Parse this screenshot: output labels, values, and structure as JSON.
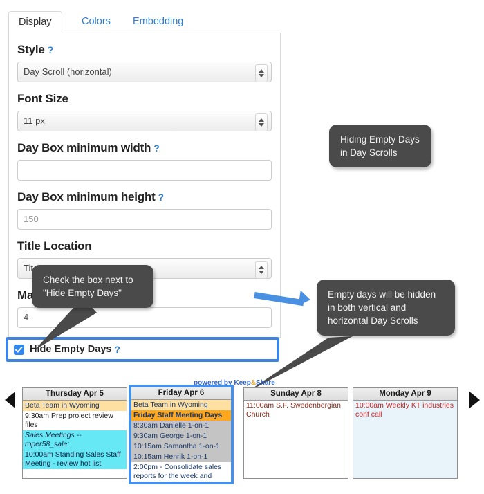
{
  "tabs": [
    {
      "label": "Display",
      "active": true
    },
    {
      "label": "Colors",
      "active": false
    },
    {
      "label": "Embedding",
      "active": false
    }
  ],
  "form": {
    "style": {
      "label": "Style",
      "help": "?",
      "value": "Day Scroll (horizontal)"
    },
    "font_size": {
      "label": "Font Size",
      "value": "11 px"
    },
    "day_box_min_width": {
      "label": "Day Box minimum width",
      "help": "?",
      "value": ""
    },
    "day_box_min_height": {
      "label": "Day Box minimum height",
      "help": "?",
      "value": "150"
    },
    "title_location": {
      "label": "Title Location",
      "value": "Tit"
    },
    "max_events": {
      "label": "Max Events Per Day",
      "help": "?",
      "value": "4"
    },
    "hide_empty_days": {
      "label": "Hide Empty Days",
      "help": "?",
      "checked": true
    }
  },
  "callouts": {
    "title": "Hiding Empty Days in Day Scrolls",
    "check_box": "Check the box next to \"Hide Empty Days\"",
    "empty_days": "Empty days will be hidden in both vertical and horizontal Day Scrolls"
  },
  "calendar": {
    "powered_by_prefix": "powered by Keep",
    "powered_by_amp": "&",
    "powered_by_suffix": "Share",
    "nav": {
      "prev": "◀",
      "next": "▶"
    },
    "columns": [
      {
        "id": "thu",
        "title": "Thursday Apr 5",
        "selected": false,
        "events": [
          {
            "text": "Beta Team in Wyoming",
            "bg": "#ffe0a3",
            "color": "#1a3a6b",
            "italic": false,
            "bold": false
          },
          {
            "text": "9:30am Prep project review files",
            "bg": "#ffffff",
            "color": "#222222",
            "italic": false,
            "bold": false
          },
          {
            "text": "Sales Meetings -- roper58_sale:",
            "bg": "#66e8f5",
            "color": "#112244",
            "italic": true,
            "bold": false
          },
          {
            "text": "10:00am Standing Sales Staff Meeting - review hot list",
            "bg": "#66e8f5",
            "color": "#112244",
            "italic": false,
            "bold": false
          }
        ]
      },
      {
        "id": "fri",
        "title": "Friday Apr 6",
        "selected": true,
        "events": [
          {
            "text": "Beta Team in Wyoming",
            "bg": "#ffe0a3",
            "color": "#1a3a6b",
            "italic": false,
            "bold": false
          },
          {
            "text": "Friday Staff Meeting Days",
            "bg": "#ffa81e",
            "color": "#1a3a6b",
            "italic": false,
            "bold": true
          },
          {
            "text": "8:30am Danielle 1-on-1",
            "bg": "#c4c4c4",
            "color": "#1a3a6b",
            "italic": false,
            "bold": false
          },
          {
            "text": "9:30am George 1-on-1",
            "bg": "#c4c4c4",
            "color": "#1a3a6b",
            "italic": false,
            "bold": false
          },
          {
            "text": "10:15am Samantha 1-on-1",
            "bg": "#c4c4c4",
            "color": "#1a3a6b",
            "italic": false,
            "bold": false
          },
          {
            "text": "10:15am Henrik 1-on-1",
            "bg": "#c4c4c4",
            "color": "#1a3a6b",
            "italic": false,
            "bold": false
          },
          {
            "text": "2:00pm - Consolidate sales reports for the week and",
            "bg": "#ffffff",
            "color": "#1a3a6b",
            "italic": false,
            "bold": false
          }
        ]
      },
      {
        "id": "sun",
        "title": "Sunday Apr 8",
        "selected": false,
        "events": [
          {
            "text": "11:00am S.F. Swedenborgian Church",
            "bg": "#ffffff",
            "color": "#8b2b1b",
            "italic": false,
            "bold": false
          }
        ]
      },
      {
        "id": "mon",
        "title": "Monday Apr 9",
        "selected": false,
        "events": [
          {
            "text": "10:00am Weekly KT industries conf call",
            "bg": "#e8f4fa",
            "color": "#cc2222",
            "italic": false,
            "bold": false
          }
        ]
      }
    ]
  },
  "colors": {
    "accent_blue": "#2d7dd2",
    "highlight_border": "#4a90e2",
    "callout_bg": "#4a4a4a"
  }
}
